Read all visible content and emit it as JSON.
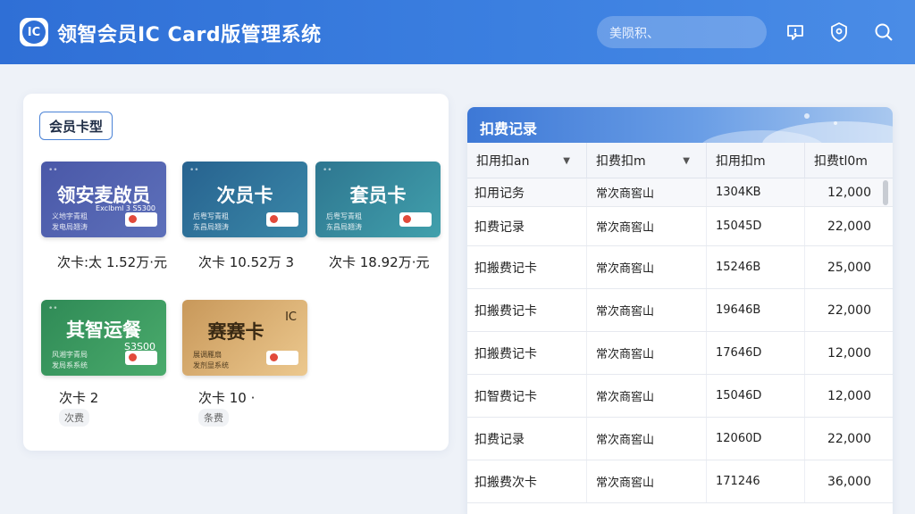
{
  "header": {
    "logo_text": "IC",
    "title": "领智会员IC Card版管理系统",
    "search_placeholder": "美陨积、",
    "icons": [
      "alert-icon",
      "shield-icon",
      "search-icon"
    ]
  },
  "left_panel": {
    "section_label": "会员卡型",
    "cards": [
      {
        "name": "领安麦啟员",
        "sub1": "义地字青粗",
        "sub2": "发电局翘涛",
        "badge": "Exclbml 3 S5300",
        "info": "次卡:太 1.52万·元",
        "color_from": "#4a58a8",
        "color_to": "#5a6cb8"
      },
      {
        "name": "次员卡",
        "sub1": "后粤写青粗",
        "sub2": "东昌局翘涛",
        "badge": "",
        "info": "次卡 10.52万 3",
        "color_from": "#27628f",
        "color_to": "#3a86a8"
      },
      {
        "name": "套员卡",
        "sub1": "后粤写青粗",
        "sub2": "东昌局翘涛",
        "badge": "",
        "info": "次卡 18.92万·元",
        "color_from": "#2e7690",
        "color_to": "#3f98a8"
      },
      {
        "name": "其智运餐",
        "sub1": "风湘字青局",
        "sub2": "发局系系统",
        "badge": "S3S00",
        "info": "次卡 2",
        "pill": "次费",
        "color_from": "#2f8a56",
        "color_to": "#46a86a"
      },
      {
        "name": "赛赛卡",
        "sub1": "展调雁扇",
        "sub2": "发剂显系统",
        "badge": "IC",
        "info": "次卡 10 ·",
        "pill": "条费",
        "color_from": "#c89a5a",
        "color_to": "#e8c48a"
      }
    ]
  },
  "right_panel": {
    "title": "扣费记录",
    "columns": [
      "扣用扣an",
      "扣费扣m",
      "扣用扣m",
      "扣费tl0m"
    ],
    "rows": [
      [
        "扣用记务",
        "常次商窖山",
        "1304KB",
        "12,000"
      ],
      [
        "扣费记录",
        "常次商窖山",
        "15045D",
        "22,000"
      ],
      [
        "扣搬费记卡",
        "常次商窖山",
        "15246B",
        "25,000"
      ],
      [
        "扣搬费记卡",
        "常次商窖山",
        "19646B",
        "22,000"
      ],
      [
        "扣搬费记卡",
        "常次商窖山",
        "17646D",
        "12,000"
      ],
      [
        "扣智费记卡",
        "常次商窖山",
        "15046D",
        "12,000"
      ],
      [
        "扣费记录",
        "常次商窖山",
        "12060D",
        "22,000"
      ],
      [
        "扣搬费次卡",
        "常次商窖山",
        "171246",
        "36,000"
      ]
    ]
  }
}
